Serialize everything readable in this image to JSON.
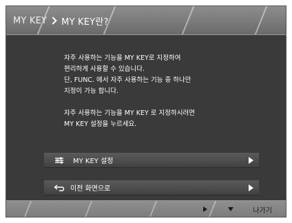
{
  "header": {
    "parent": "MY KEY",
    "current": "MY KEY란?"
  },
  "body": {
    "paragraph_1": [
      "자주 사용하는 기능을 MY KEY로 지정하여",
      "편리하게 사용할 수 있습니다.",
      "단, FUNC. 에서 자주 사용하는 기능 중 하나만",
      "지정이 가능 합니다."
    ],
    "paragraph_2": [
      "자주 사용하는 기능을 MY KEY 로 지정하시려면",
      "MY KEY 설정을 누르세요."
    ]
  },
  "buttons": {
    "mykey_settings": {
      "label": "MY KEY 설정",
      "icon": "settings-sliders-icon"
    },
    "previous_screen": {
      "label": "이전 화면으로",
      "icon": "return-arrow-icon"
    }
  },
  "footer": {
    "exit_label": "나가기",
    "icons": [
      "play-right-icon",
      "down-triangle-icon"
    ]
  },
  "colors": {
    "screen_bg": "#3a3a3a",
    "header_bg": "#7a7a7a",
    "button_bg": "#4c4c4c",
    "footer_bg": "#8a8a8a",
    "text": "#ffffff"
  }
}
